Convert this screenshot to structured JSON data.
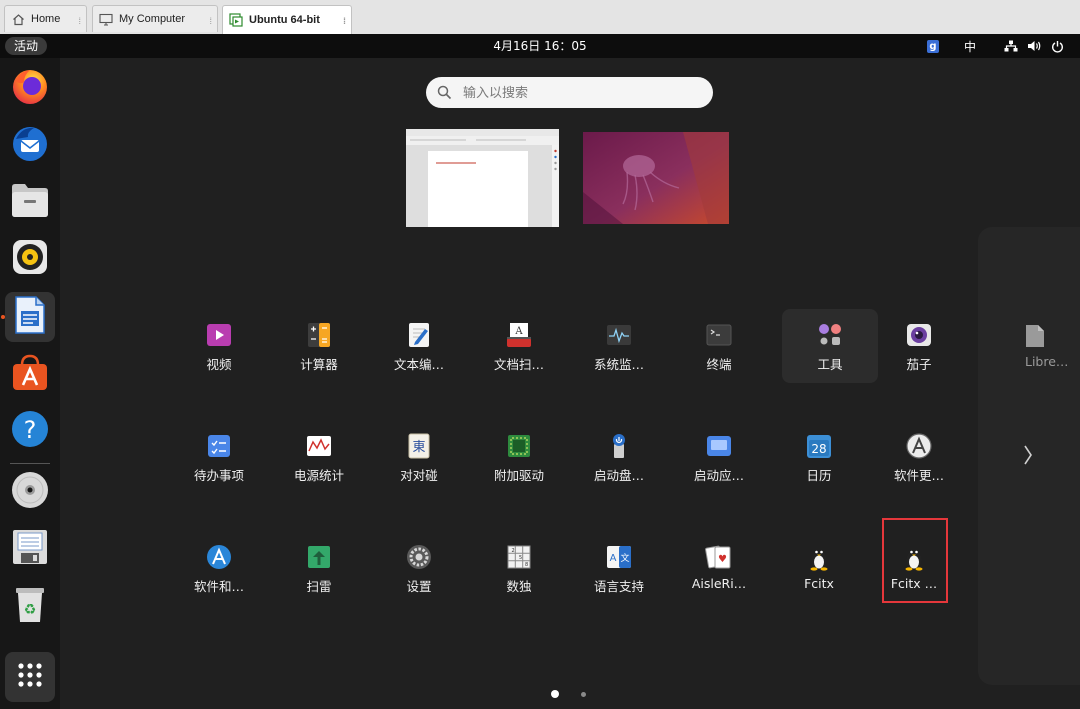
{
  "vm_tabs": [
    {
      "label": "Home",
      "icon": "home-icon"
    },
    {
      "label": "My Computer",
      "icon": "computer-icon"
    },
    {
      "label": "Ubuntu 64-bit",
      "icon": "vm-icon"
    }
  ],
  "topbar": {
    "activities": "活动",
    "clock": "4月16日 16：05",
    "input_badge": "g",
    "input_method": "中"
  },
  "dock": [
    {
      "name": "firefox-icon"
    },
    {
      "name": "thunderbird-icon"
    },
    {
      "name": "files-icon"
    },
    {
      "name": "rhythmbox-icon"
    },
    {
      "name": "libreoffice-writer-icon"
    },
    {
      "name": "app-center-icon"
    },
    {
      "name": "help-icon"
    },
    {
      "name": "disc-icon"
    },
    {
      "name": "floppy-icon"
    },
    {
      "name": "trash-icon"
    },
    {
      "name": "show-apps-icon"
    }
  ],
  "search": {
    "placeholder": "输入以搜索"
  },
  "apps": [
    {
      "label": "视频",
      "icon": "videos-icon"
    },
    {
      "label": "计算器",
      "icon": "calculator-icon"
    },
    {
      "label": "文本编…",
      "icon": "text-editor-icon"
    },
    {
      "label": "文档扫…",
      "icon": "document-scanner-icon"
    },
    {
      "label": "系统监…",
      "icon": "system-monitor-icon"
    },
    {
      "label": "终端",
      "icon": "terminal-icon"
    },
    {
      "label": "工具",
      "icon": "utilities-folder-icon"
    },
    {
      "label": "茄子",
      "icon": "cheese-icon"
    },
    {
      "label": "待办事项",
      "icon": "todo-icon"
    },
    {
      "label": "电源统计",
      "icon": "power-statistics-icon"
    },
    {
      "label": "对对碰",
      "icon": "mahjongg-icon"
    },
    {
      "label": "附加驱动",
      "icon": "additional-drivers-icon"
    },
    {
      "label": "启动盘…",
      "icon": "startup-disk-icon"
    },
    {
      "label": "启动应…",
      "icon": "startup-apps-icon"
    },
    {
      "label": "日历",
      "icon": "calendar-icon"
    },
    {
      "label": "软件更…",
      "icon": "software-updater-icon"
    },
    {
      "label": "软件和…",
      "icon": "software-sources-icon"
    },
    {
      "label": "扫雷",
      "icon": "mines-icon"
    },
    {
      "label": "设置",
      "icon": "settings-icon"
    },
    {
      "label": "数独",
      "icon": "sudoku-icon"
    },
    {
      "label": "语言支持",
      "icon": "language-support-icon"
    },
    {
      "label": "AisleRi…",
      "icon": "aisleriot-icon"
    },
    {
      "label": "Fcitx",
      "icon": "fcitx-icon"
    },
    {
      "label": "Fcitx …",
      "icon": "fcitx-config-icon"
    }
  ],
  "calendar_day": "28",
  "next_page_app": {
    "label": "Libre…",
    "icon": "libreoffice-icon"
  },
  "page_count": 2,
  "current_page": 1,
  "highlight_color": "#e5373b",
  "accent_color": "#e95420"
}
